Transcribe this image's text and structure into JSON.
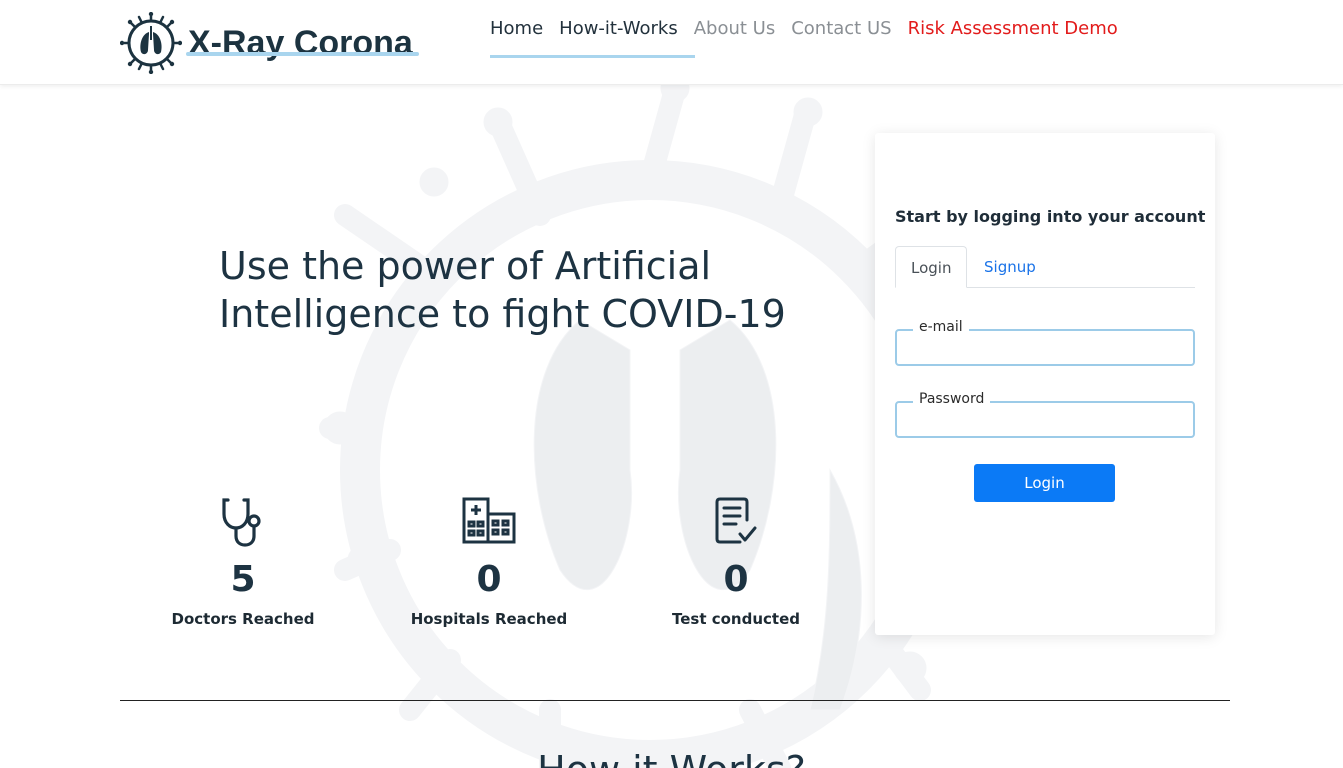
{
  "brand": {
    "name": "X-Ray Corona"
  },
  "nav": {
    "items": [
      {
        "label": "Home"
      },
      {
        "label": "How-it-Works"
      },
      {
        "label": "About Us"
      },
      {
        "label": "Contact US"
      },
      {
        "label": "Risk Assessment Demo"
      }
    ]
  },
  "hero": {
    "title": "Use the power of Artificial Intelligence to fight COVID-19"
  },
  "stats": [
    {
      "value": "5",
      "label": "Doctors Reached",
      "icon": "stethoscope-icon"
    },
    {
      "value": "0",
      "label": "Hospitals Reached",
      "icon": "hospital-icon"
    },
    {
      "value": "0",
      "label": "Test conducted",
      "icon": "test-report-icon"
    }
  ],
  "login": {
    "title": "Start by logging into your account",
    "tabs": [
      {
        "label": "Login"
      },
      {
        "label": "Signup"
      }
    ],
    "email_label": "e-mail",
    "password_label": "Password",
    "button_label": "Login"
  },
  "section": {
    "heading": "How it Works?"
  },
  "colors": {
    "accent": "#0b7af6",
    "nav_active_underline": "#a9d5ee",
    "demo_red": "#e21b1b",
    "dark_text": "#1d3342"
  }
}
